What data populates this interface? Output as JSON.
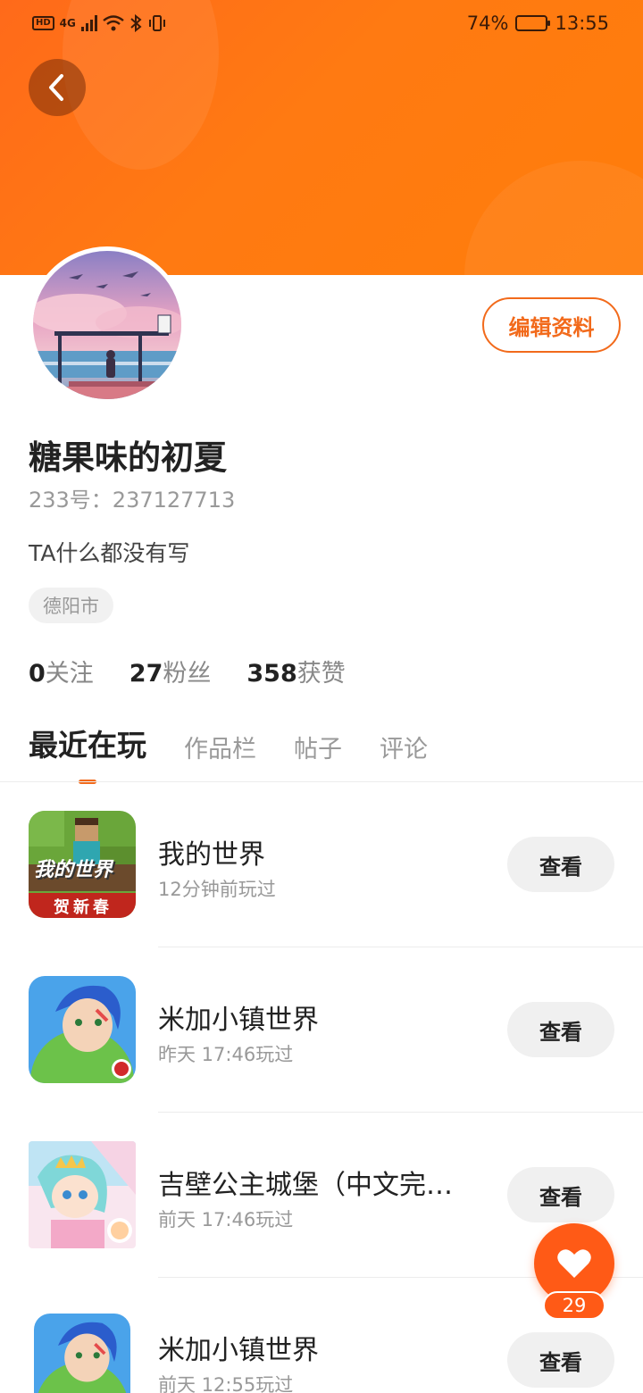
{
  "status_bar": {
    "hd": "HD",
    "network": "4G",
    "battery_percent": "74%",
    "time": "13:55"
  },
  "profile": {
    "username": "糖果味的初夏",
    "id_line": "233号：237127713",
    "bio": "TA什么都没有写",
    "location": "德阳市",
    "edit_button": "编辑资料"
  },
  "stats": [
    {
      "value": "0",
      "label": "关注"
    },
    {
      "value": "27",
      "label": "粉丝"
    },
    {
      "value": "358",
      "label": "获赞"
    }
  ],
  "tabs": [
    {
      "label": "最近在玩",
      "active": true
    },
    {
      "label": "作品栏",
      "active": false
    },
    {
      "label": "帖子",
      "active": false
    },
    {
      "label": "评论",
      "active": false
    }
  ],
  "games": [
    {
      "title": "我的世界",
      "meta": "12分钟前玩过",
      "button": "查看",
      "icon_text": "我的世界",
      "icon_sub": "贺新春"
    },
    {
      "title": "米加小镇世界",
      "meta": "昨天 17:46玩过",
      "button": "查看"
    },
    {
      "title": "吉壁公主城堡（中文完…",
      "meta": "前天 17:46玩过",
      "button": "查看"
    },
    {
      "title": "米加小镇世界",
      "meta": "前天 12:55玩过",
      "button": "查看"
    }
  ],
  "like": {
    "count": "29"
  },
  "colors": {
    "accent": "#f26a1b",
    "banner": "#ff7a12",
    "fab": "#ff5a16"
  }
}
